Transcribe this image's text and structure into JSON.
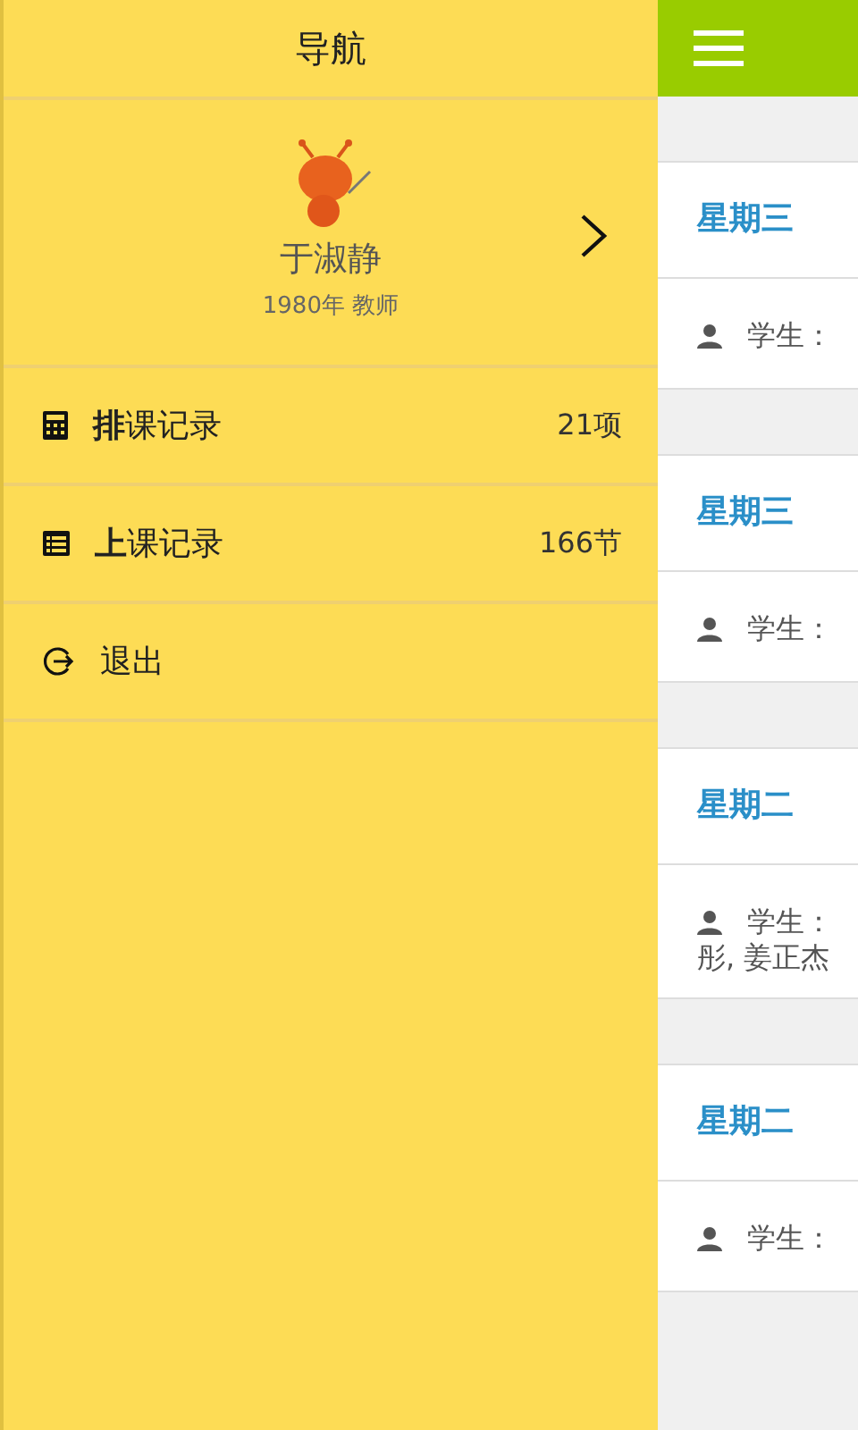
{
  "drawer": {
    "title": "导航",
    "profile": {
      "name": "于淑静",
      "info": "1980年  教师"
    },
    "items": [
      {
        "kind": "calculator",
        "label": "**排**课记录",
        "count": "21项"
      },
      {
        "kind": "list",
        "label": "**上**课记录",
        "count": "166节"
      },
      {
        "kind": "logout",
        "label": "退出"
      }
    ]
  },
  "main": {
    "cards": [
      {
        "day": "星期三",
        "students": [
          "学生："
        ]
      },
      {
        "day": "星期三",
        "students": [
          "学生："
        ]
      },
      {
        "day": "星期二",
        "students": [
          "学生：",
          "彤, 姜正杰"
        ]
      },
      {
        "day": "星期二",
        "students": [
          "学生："
        ]
      }
    ]
  }
}
